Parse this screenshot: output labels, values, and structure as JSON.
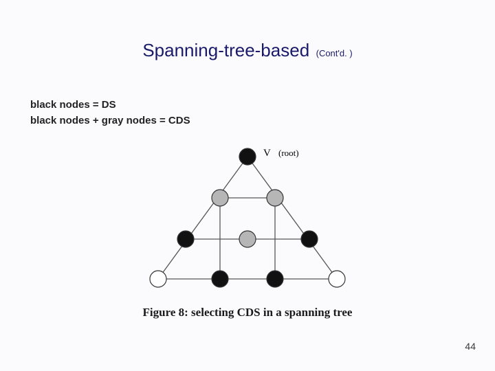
{
  "title": "Spanning-tree-based",
  "contd": "(Cont'd. )",
  "legend_line1": "black nodes = DS",
  "legend_line2": "black nodes + gray nodes = CDS",
  "root_label_v": "V",
  "root_label_root": "(root)",
  "caption": "Figure 8: selecting CDS in a spanning tree",
  "page": "44"
}
